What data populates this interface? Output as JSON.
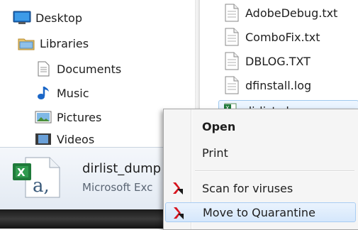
{
  "nav_pane": {
    "items": [
      {
        "label": "Desktop",
        "icon": "desktop-icon"
      },
      {
        "label": "Libraries",
        "icon": "libraries-folder-icon"
      },
      {
        "label": "Documents",
        "icon": "documents-icon"
      },
      {
        "label": "Music",
        "icon": "music-icon"
      },
      {
        "label": "Pictures",
        "icon": "pictures-icon"
      },
      {
        "label": "Videos",
        "icon": "videos-icon"
      }
    ]
  },
  "file_pane": {
    "items": [
      {
        "label": "AdobeDebug.txt",
        "icon": "text-file-icon"
      },
      {
        "label": "ComboFix.txt",
        "icon": "text-file-icon"
      },
      {
        "label": "DBLOG.TXT",
        "icon": "text-file-icon"
      },
      {
        "label": "dfinstall.log",
        "icon": "text-file-icon"
      },
      {
        "label": "dirlist_dump",
        "icon": "excel-csv-icon",
        "selected": true
      }
    ]
  },
  "details_pane": {
    "file_name": "dirlist_dump",
    "file_type": "Microsoft Exc",
    "icon": "excel-csv-icon"
  },
  "context_menu": {
    "items": [
      {
        "label": "Open",
        "bold": true
      },
      {
        "label": "Print"
      },
      {
        "label": "Scan for viruses",
        "icon": "antivirus-icon"
      },
      {
        "label": "Move to Quarantine",
        "icon": "antivirus-icon",
        "hover": true
      }
    ]
  },
  "colors": {
    "selection_fill": "#d9ebfd",
    "selection_border": "#9ec8ee",
    "antivirus_red": "#d8141e"
  }
}
